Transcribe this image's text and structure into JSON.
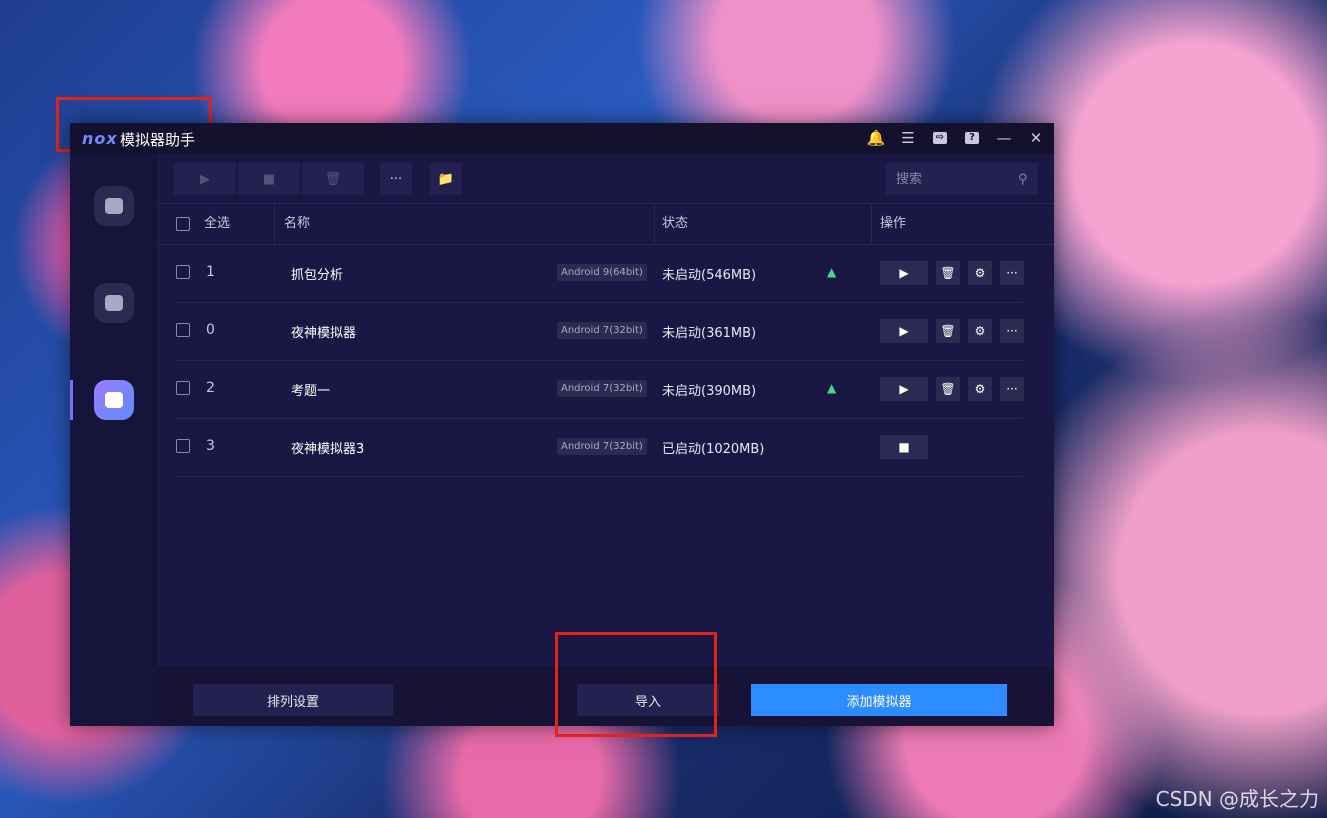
{
  "app": {
    "logo": "nox",
    "title": "模拟器助手"
  },
  "titlebar_icons": [
    "bell-icon",
    "menu-icon",
    "export-icon",
    "help-icon",
    "minimize-icon",
    "close-icon"
  ],
  "toolbar": {
    "more_label": "···"
  },
  "search": {
    "placeholder": "搜索"
  },
  "table": {
    "headers": {
      "select_all": "全选",
      "name": "名称",
      "status": "状态",
      "actions": "操作"
    },
    "rows": [
      {
        "index": "1",
        "name": "抓包分析",
        "android": "Android 9(64bit)",
        "status": "未启动(546MB)",
        "android_icon": true,
        "running": false
      },
      {
        "index": "0",
        "name": "夜神模拟器",
        "android": "Android 7(32bit)",
        "status": "未启动(361MB)",
        "android_icon": false,
        "running": false
      },
      {
        "index": "2",
        "name": "考题一",
        "android": "Android 7(32bit)",
        "status": "未启动(390MB)",
        "android_icon": true,
        "running": false
      },
      {
        "index": "3",
        "name": "夜神模拟器3",
        "android": "Android 7(32bit)",
        "status": "已启动(1020MB)",
        "android_icon": false,
        "running": true
      }
    ]
  },
  "footer": {
    "sort_label": "排列设置",
    "import_label": "导入",
    "add_label": "添加模拟器"
  },
  "watermark": "CSDN @成长之力",
  "colors": {
    "accent": "#2d8cff",
    "highlight": "#e2231a",
    "android_green": "#3ddc84",
    "window_bg": "#1b1745"
  }
}
